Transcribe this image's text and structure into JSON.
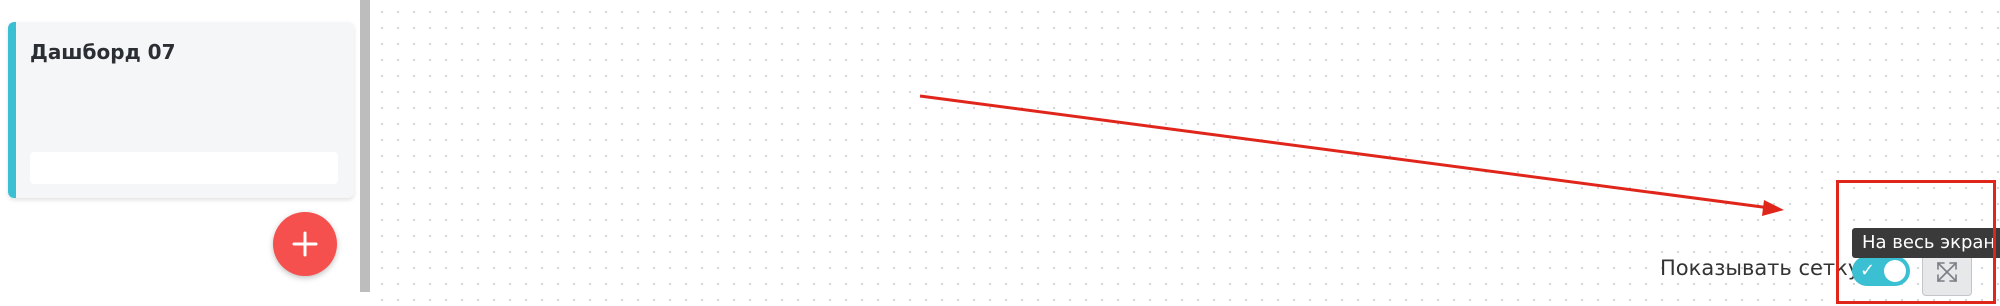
{
  "sidebar": {
    "dashboard_card": {
      "title": "Дашборд 07"
    },
    "add_button": {
      "icon": "plus-icon"
    }
  },
  "canvas": {
    "grid_toggle": {
      "label": "Показывать сетку",
      "enabled": true
    },
    "fullscreen": {
      "icon": "fullscreen-icon",
      "tooltip": "На весь экран"
    }
  },
  "colors": {
    "accent": "#3bbfd3",
    "add_button": "#f5504e",
    "annotation": "#e0261b"
  }
}
